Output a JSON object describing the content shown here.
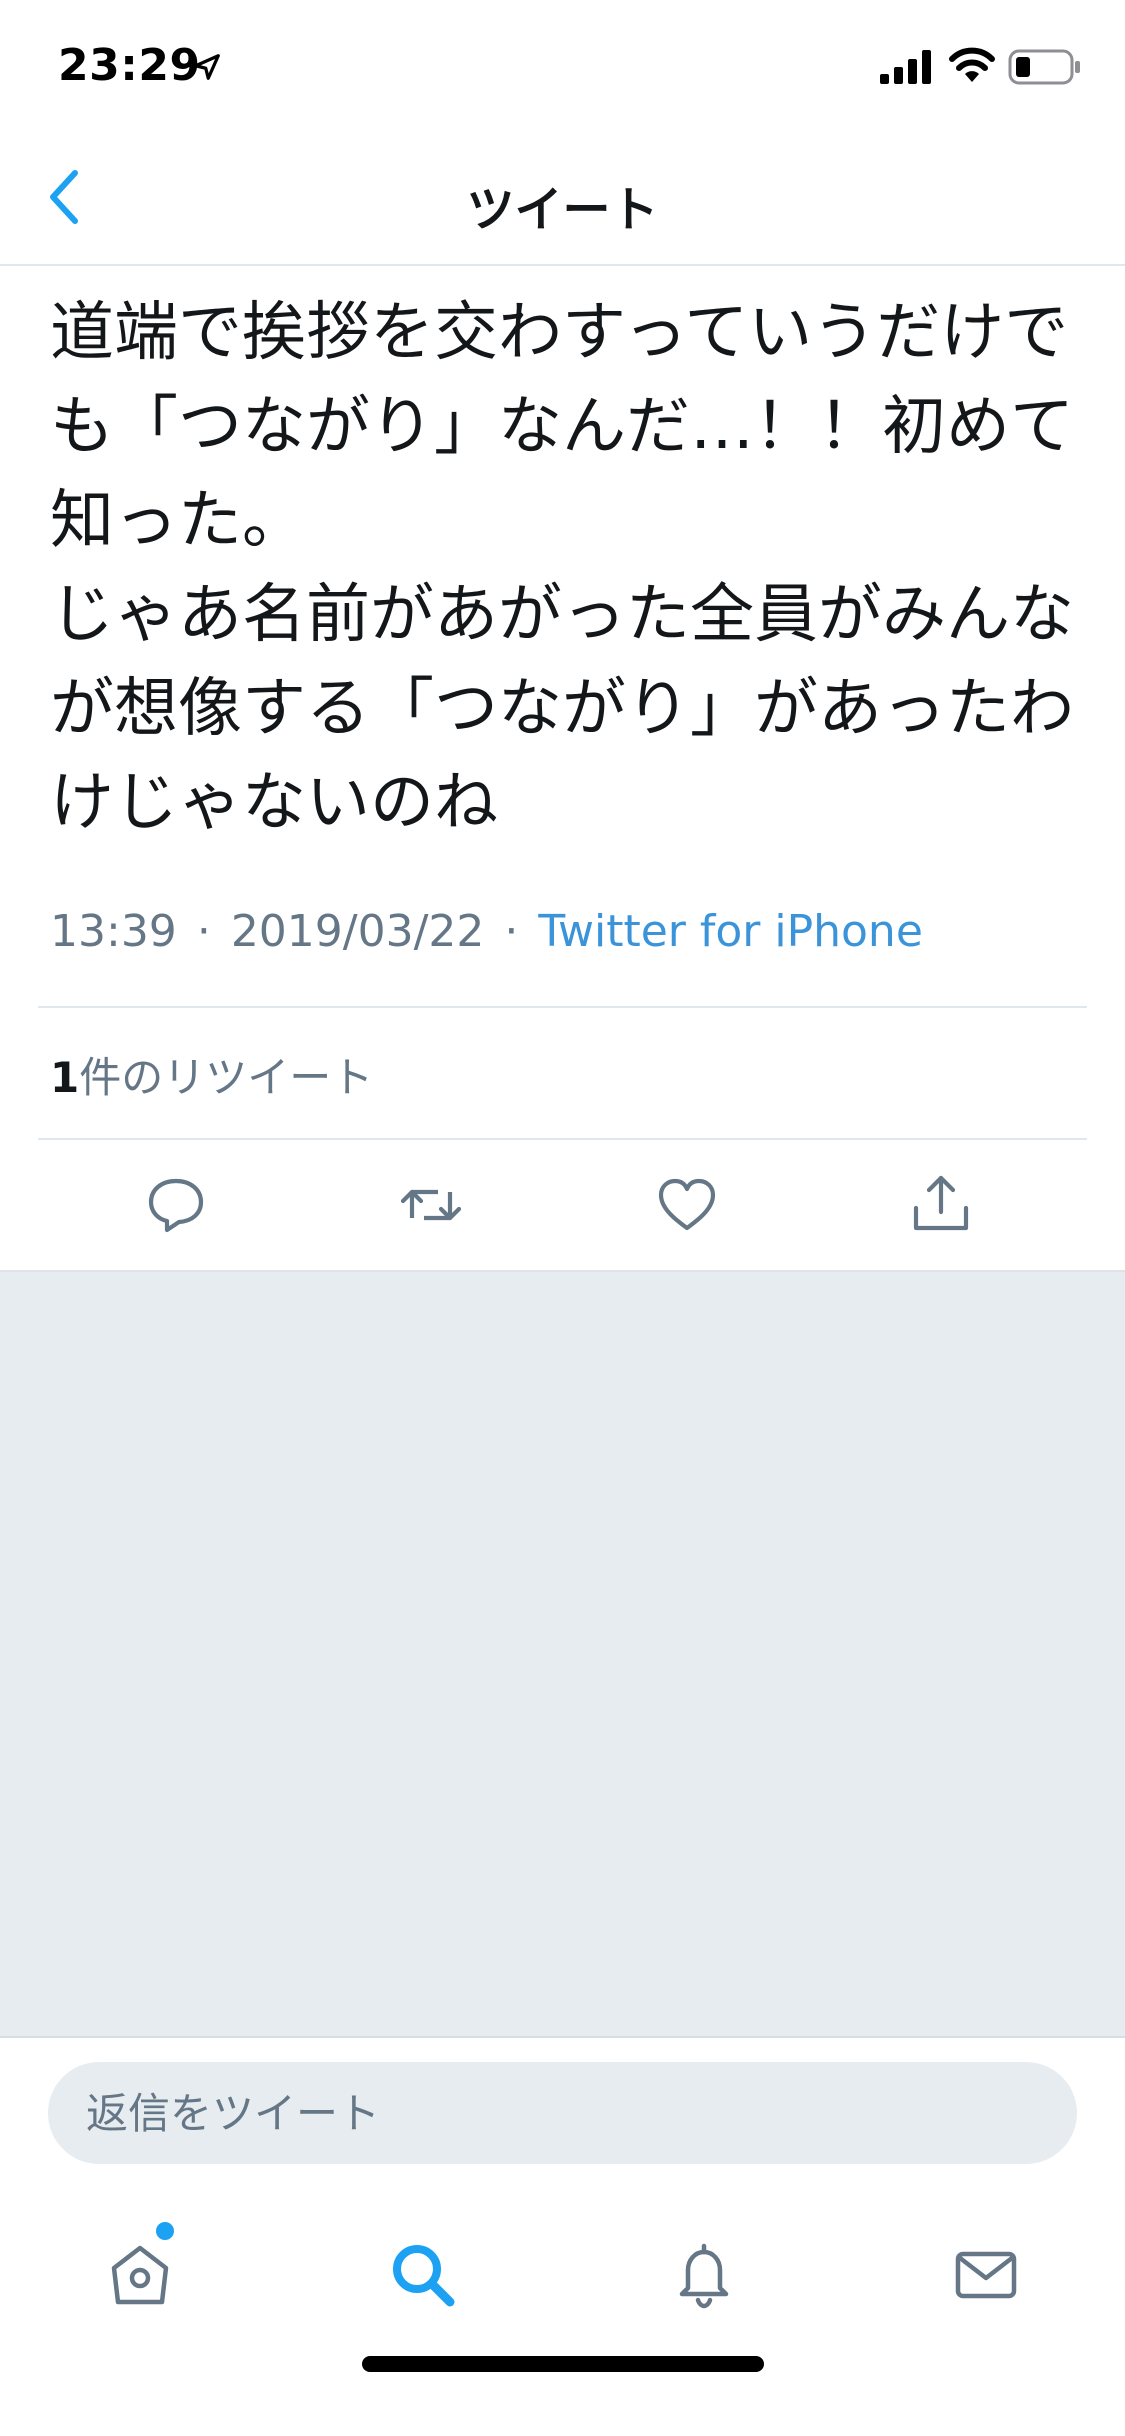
{
  "status_bar": {
    "time": "23:29",
    "icons": [
      "location-arrow-icon",
      "cellular-signal-icon",
      "wifi-icon",
      "battery-icon"
    ]
  },
  "nav": {
    "title": "ツイート",
    "back_icon": "chevron-left-icon"
  },
  "tweet": {
    "text": "道端で挨拶を交わすっていうだけでも「つながり」なんだ…！！初めて知った。\nじゃあ名前があがった全員がみんなが想像する「つながり」があったわけじゃないのね",
    "time": "13:39",
    "date": "2019/03/22",
    "separator": "·",
    "source": "Twitter for iPhone",
    "retweet_count": "1",
    "retweet_label": "件のリツイート"
  },
  "actions": [
    "reply-icon",
    "retweet-icon",
    "like-icon",
    "share-icon"
  ],
  "reply_box": {
    "placeholder": "返信をツイート"
  },
  "tab_bar": [
    "home-icon",
    "search-icon",
    "notifications-icon",
    "messages-icon"
  ],
  "colors": {
    "accent": "#1da1f2",
    "link": "#3b94d9",
    "secondary_text": "#657786",
    "background_gray": "#e6ecf0",
    "divider": "#e1e8ed"
  }
}
